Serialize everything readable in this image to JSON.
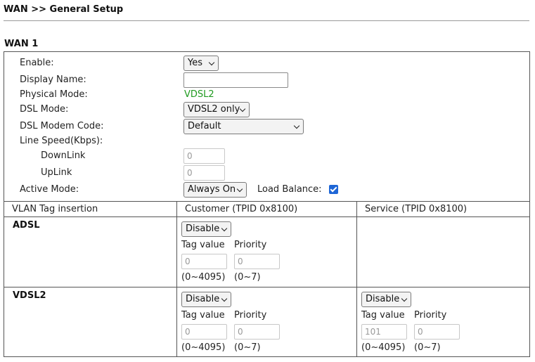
{
  "page": {
    "title": "WAN >> General Setup"
  },
  "wan": {
    "section_title": "WAN 1",
    "enable": {
      "label": "Enable:",
      "value": "Yes"
    },
    "display_name": {
      "label": "Display Name:",
      "value": ""
    },
    "physical_mode": {
      "label": "Physical Mode:",
      "value": "VDSL2"
    },
    "dsl_mode": {
      "label": "DSL Mode:",
      "value": "VDSL2 only"
    },
    "dsl_modem_code": {
      "label": "DSL Modem Code:",
      "value": "Default"
    },
    "line_speed": {
      "label": "Line Speed(Kbps):",
      "downlink_label": "DownLink",
      "downlink_value": "0",
      "uplink_label": "UpLink",
      "uplink_value": "0"
    },
    "active_mode": {
      "label": "Active Mode:",
      "value": "Always On"
    },
    "load_balance": {
      "label": "Load Balance:",
      "checked": true
    }
  },
  "vlan": {
    "headers": [
      "VLAN Tag insertion",
      "Customer (TPID 0x8100)",
      "Service (TPID 0x8100)"
    ],
    "tag_value_label": "Tag value",
    "priority_label": "Priority",
    "tag_range": "(0~4095)",
    "priority_range": "(0~7)",
    "rows": [
      {
        "name": "ADSL",
        "customer": {
          "mode": "Disable",
          "tag": "0",
          "priority": "0"
        }
      },
      {
        "name": "VDSL2",
        "customer": {
          "mode": "Disable",
          "tag": "0",
          "priority": "0"
        },
        "service": {
          "mode": "Disable",
          "tag": "101",
          "priority": "0"
        }
      }
    ]
  }
}
